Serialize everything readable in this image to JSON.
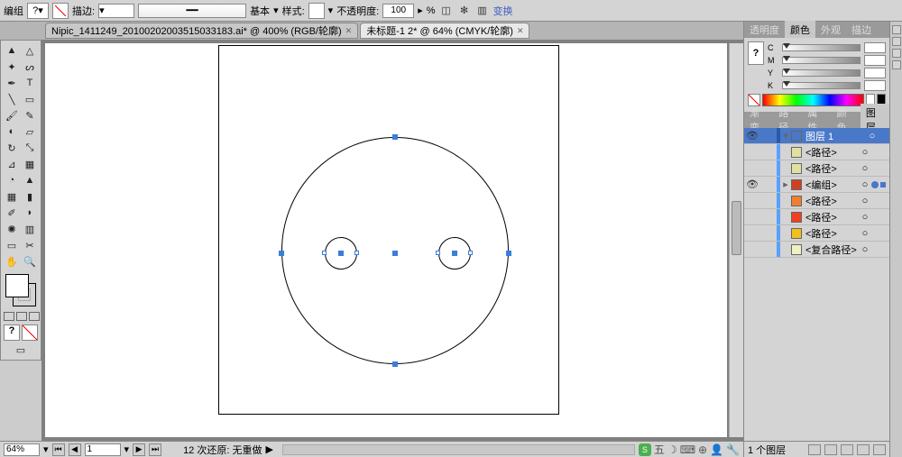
{
  "topbar": {
    "group_label": "编组",
    "stroke_label": "描边:",
    "basic_label": "基本",
    "style_label": "样式:",
    "opacity_label": "不透明度:",
    "opacity_value": "100",
    "percent": "%",
    "transform_link": "变换"
  },
  "tabs": [
    {
      "label": "Nipic_1411249_201002020035150331​83.ai* @ 400% (RGB/轮廓)"
    },
    {
      "label": "未标题-1 2* @ 64% (CMYK/轮廓)"
    }
  ],
  "status": {
    "zoom": "64%",
    "page": "1",
    "undo_text": "12 次还原: 无重做"
  },
  "ime": {
    "label": "五"
  },
  "color_panel": {
    "tabs": [
      "透明度",
      "颜色",
      "外观",
      "描边"
    ],
    "channels": [
      "C",
      "M",
      "Y",
      "K"
    ]
  },
  "layers_panel": {
    "tabs": [
      "渐变",
      "路径",
      "属性",
      "颜色",
      "图层"
    ],
    "top_layer": "图层 1",
    "items": [
      {
        "name": "<路径>",
        "color": "#e0e0a0"
      },
      {
        "name": "<路径>",
        "color": "#e0e0a0"
      },
      {
        "name": "<编组>",
        "color": "#d04020",
        "selected": true
      },
      {
        "name": "<路径>",
        "color": "#f08030"
      },
      {
        "name": "<路径>",
        "color": "#f04020"
      },
      {
        "name": "<路径>",
        "color": "#f0c020"
      },
      {
        "name": "<复合路径>",
        "color": "#f0f0c0"
      }
    ],
    "footer": "1 个图层"
  }
}
